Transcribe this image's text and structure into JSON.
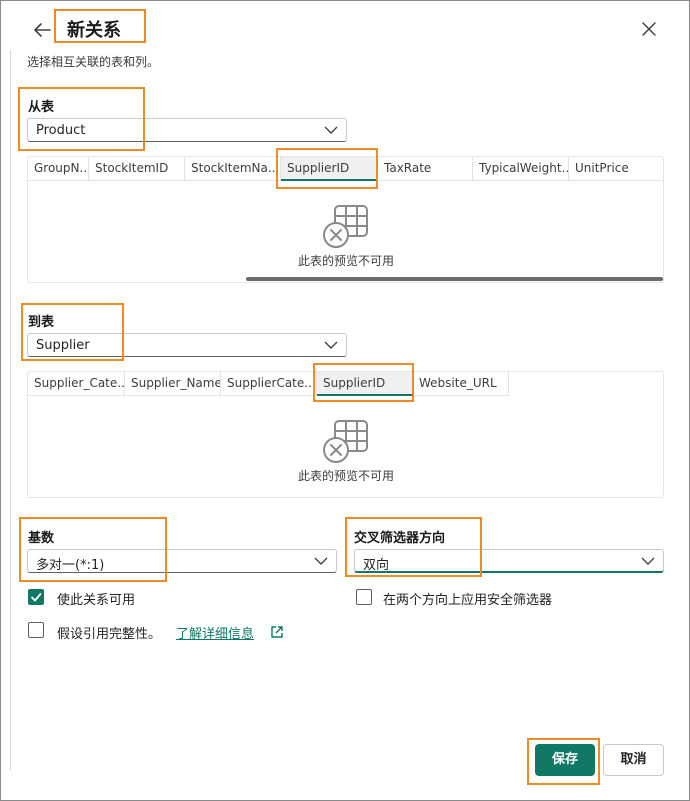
{
  "dialog": {
    "title": "新关系",
    "subtitle": "选择相互关联的表和列。"
  },
  "from_table": {
    "label": "从表",
    "selected": "Product",
    "columns": [
      "GroupN...",
      "StockItemID",
      "StockItemNa...",
      "SupplierID",
      "TaxRate",
      "TypicalWeight...",
      "UnitPrice"
    ],
    "selected_column": "SupplierID",
    "empty_text": "此表的预览不可用"
  },
  "to_table": {
    "label": "到表",
    "selected": "Supplier",
    "columns": [
      "Supplier_Cate...",
      "Supplier_Name",
      "SupplierCate...",
      "SupplierID",
      "Website_URL"
    ],
    "selected_column": "SupplierID",
    "empty_text": "此表的预览不可用"
  },
  "cardinality": {
    "label": "基数",
    "selected": "多对一(*:1)"
  },
  "cross_filter": {
    "label": "交叉筛选器方向",
    "selected": "双向"
  },
  "options": {
    "make_active": {
      "label": "使此关系可用",
      "checked": true
    },
    "security_filter": {
      "label": "在两个方向上应用安全筛选器",
      "checked": false
    },
    "referential_integrity": {
      "label": "假设引用完整性。",
      "checked": false
    },
    "learn_more": "了解详细信息"
  },
  "footer": {
    "save_label": "保存",
    "cancel_label": "取消"
  },
  "colors": {
    "accent": "#117865",
    "highlight": "#f08a24"
  }
}
